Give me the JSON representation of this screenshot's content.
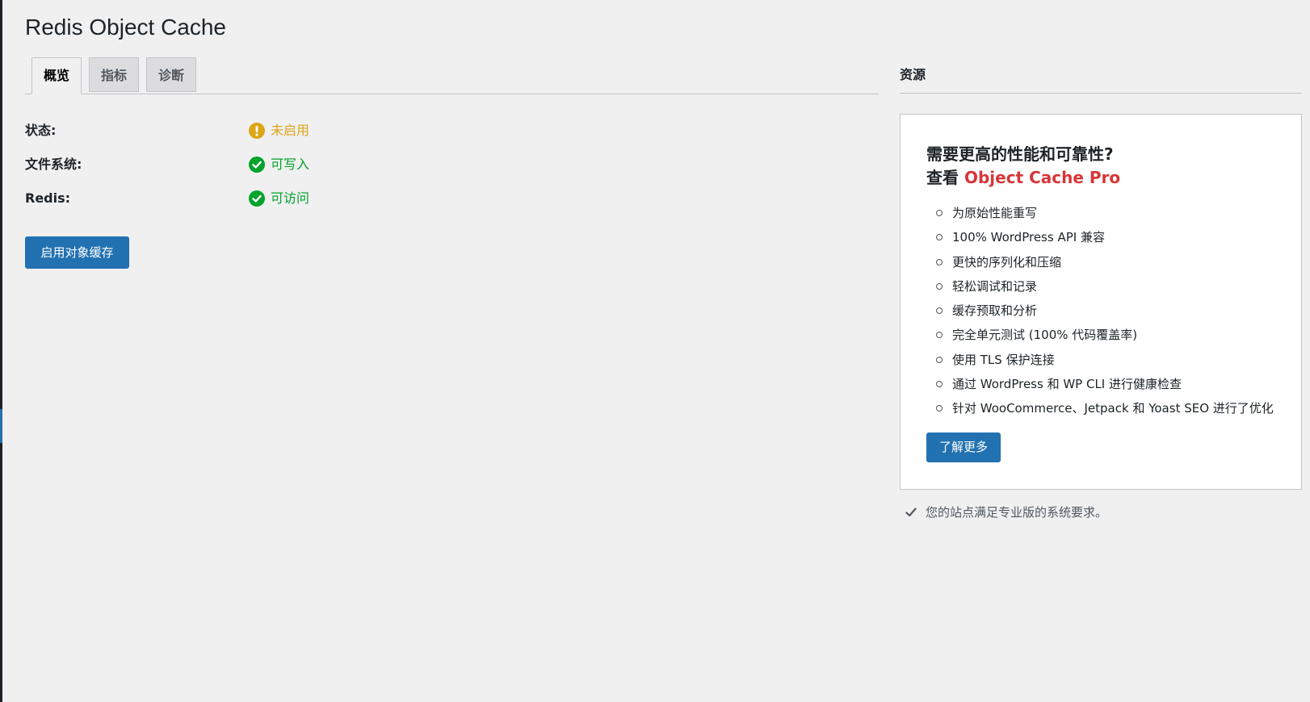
{
  "page": {
    "title": "Redis Object Cache"
  },
  "tabs": [
    {
      "label": "概览",
      "active": true
    },
    {
      "label": "指标",
      "active": false
    },
    {
      "label": "诊断",
      "active": false
    }
  ],
  "status_rows": [
    {
      "label": "状态:",
      "value": "未启用",
      "icon": "warning-icon",
      "color": "#dba617"
    },
    {
      "label": "文件系统:",
      "value": "可写入",
      "icon": "check-circle-icon",
      "color": "#00a32a"
    },
    {
      "label": "Redis:",
      "value": "可访问",
      "icon": "check-circle-icon",
      "color": "#00a32a"
    }
  ],
  "actions": {
    "enable_label": "启用对象缓存"
  },
  "sidebar": {
    "title": "资源",
    "promo": {
      "heading_line1": "需要更高的性能和可靠性?",
      "heading_line2_prefix": "查看 ",
      "heading_brand": "Object Cache Pro",
      "features": [
        "为原始性能重写",
        "100% WordPress API 兼容",
        "更快的序列化和压缩",
        "轻松调试和记录",
        "缓存预取和分析",
        "完全单元测试 (100% 代码覆盖率)",
        "使用 TLS 保护连接",
        "通过 WordPress 和 WP CLI 进行健康检查",
        "针对 WooCommerce、Jetpack 和 Yoast SEO 进行了优化"
      ],
      "learn_more_label": "了解更多"
    },
    "requirements_note": "您的站点满足专业版的系统要求。"
  },
  "colors": {
    "accent": "#2271b1",
    "warning": "#dba617",
    "success": "#00a32a",
    "brand_red": "#d63638"
  }
}
